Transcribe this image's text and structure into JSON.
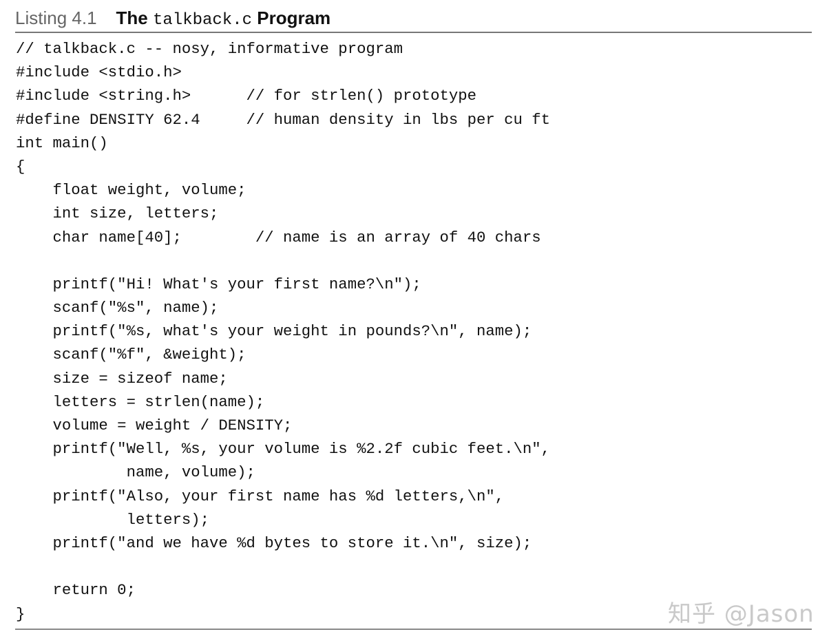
{
  "caption": {
    "number": "Listing 4.1",
    "prefix": "The ",
    "filename": "talkback.c",
    "suffix": " Program"
  },
  "code_lines": [
    "// talkback.c -- nosy, informative program",
    "#include <stdio.h>",
    "#include <string.h>      // for strlen() prototype",
    "#define DENSITY 62.4     // human density in lbs per cu ft",
    "int main()",
    "{",
    "    float weight, volume;",
    "    int size, letters;",
    "    char name[40];        // name is an array of 40 chars",
    "",
    "    printf(\"Hi! What's your first name?\\n\");",
    "    scanf(\"%s\", name);",
    "    printf(\"%s, what's your weight in pounds?\\n\", name);",
    "    scanf(\"%f\", &weight);",
    "    size = sizeof name;",
    "    letters = strlen(name);",
    "    volume = weight / DENSITY;",
    "    printf(\"Well, %s, your volume is %2.2f cubic feet.\\n\",",
    "            name, volume);",
    "    printf(\"Also, your first name has %d letters,\\n\",",
    "            letters);",
    "    printf(\"and we have %d bytes to store it.\\n\", size);",
    "",
    "    return 0;",
    "}"
  ],
  "watermark": "知乎 @Jason"
}
